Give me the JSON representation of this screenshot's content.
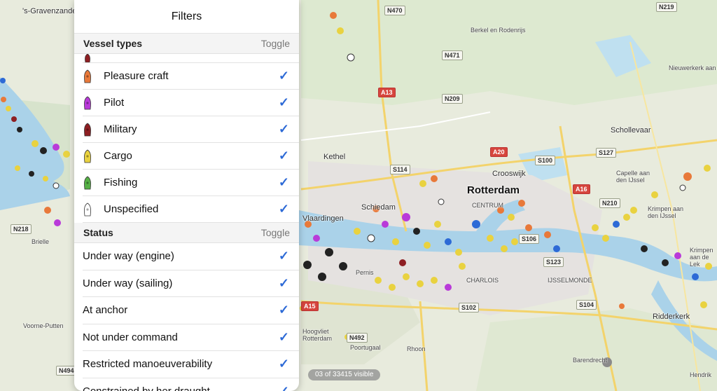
{
  "panel": {
    "title": "Filters",
    "vessel_types": {
      "header": "Vessel types",
      "toggle": "Toggle",
      "items": [
        {
          "label": "Pleasure craft",
          "color": "#e8793a",
          "icon": "pleasure-craft-icon"
        },
        {
          "label": "Pilot",
          "color": "#b93ad9",
          "icon": "pilot-icon"
        },
        {
          "label": "Military",
          "color": "#8e1f23",
          "icon": "military-icon"
        },
        {
          "label": "Cargo",
          "color": "#e9d240",
          "icon": "cargo-icon"
        },
        {
          "label": "Fishing",
          "color": "#56b046",
          "icon": "fishing-icon"
        },
        {
          "label": "Unspecified",
          "color": "#ffffff",
          "icon": "unspecified-icon"
        }
      ]
    },
    "status": {
      "header": "Status",
      "toggle": "Toggle",
      "items": [
        {
          "label": "Under way (engine)"
        },
        {
          "label": "Under way (sailing)"
        },
        {
          "label": "At anchor"
        },
        {
          "label": "Not under command"
        },
        {
          "label": "Restricted manoeuverability"
        },
        {
          "label": "Constrained by her draught"
        }
      ]
    },
    "check_color": "#2d6ad6"
  },
  "map": {
    "places": [
      "'s-Gravenzande",
      "Berkel en Rodenrijs",
      "Nieuwerkerk aan den IJssel",
      "Schollevaar",
      "Kethel",
      "Crooswijk",
      "Rotterdam",
      "CENTRUM",
      "Capelle aan den IJssel",
      "Krimpen aan den IJssel",
      "Schiedam",
      "Vlaardingen",
      "Pernis",
      "CHARLOIS",
      "IJSSELMONDE",
      "Ridderkerk",
      "Hoogvliet Rotterdam",
      "Poortugaal",
      "Rhoon",
      "Barendrecht",
      "Voorne-Putten",
      "Brielle",
      "Hendrik",
      "Krimpen aan de Lek"
    ],
    "roads": [
      "N470",
      "N219",
      "N471",
      "N209",
      "A13",
      "A20",
      "S100",
      "S127",
      "S114",
      "A16",
      "N210",
      "S106",
      "S123",
      "A15",
      "S102",
      "S104",
      "N492",
      "N218",
      "N494"
    ],
    "count_text": "03 of 33415 visible"
  }
}
